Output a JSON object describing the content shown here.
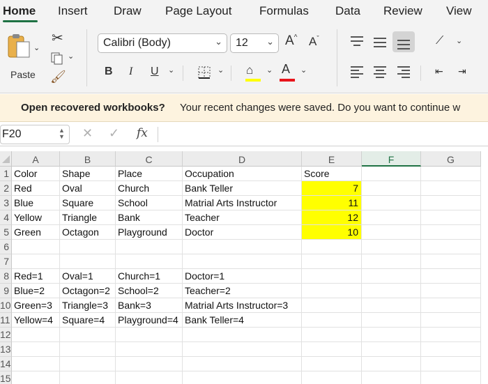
{
  "tabs": [
    "Home",
    "Insert",
    "Draw",
    "Page Layout",
    "Formulas",
    "Data",
    "Review",
    "View"
  ],
  "ribbon": {
    "paste_label": "Paste",
    "font_name": "Calibri (Body)",
    "font_size": "12",
    "grow_font": "A",
    "shrink_font": "A",
    "bold": "B",
    "italic": "I",
    "underline": "U",
    "font_color_glyph": "A",
    "fill_color": "#ffff00",
    "font_color": "#e8141b"
  },
  "message_bar": {
    "title": "Open recovered workbooks?",
    "text": "Your recent changes were saved. Do you want to continue w"
  },
  "formula_bar": {
    "name_box": "F20",
    "fx": "fx",
    "cancel": "✕",
    "ok": "✓",
    "formula": ""
  },
  "sheet": {
    "columns": [
      "A",
      "B",
      "C",
      "D",
      "E",
      "F",
      "G"
    ],
    "selected_column": "F",
    "rows": [
      "1",
      "2",
      "3",
      "4",
      "5",
      "6",
      "7",
      "8",
      "9",
      "10",
      "11",
      "12",
      "13",
      "14",
      "15"
    ],
    "highlight_color": "#ffff00",
    "cells": [
      [
        "Color",
        "Shape",
        "Place",
        "Occupation",
        "Score",
        "",
        ""
      ],
      [
        "Red",
        "Oval",
        "Church",
        "Bank Teller",
        "7",
        "",
        ""
      ],
      [
        "Blue",
        "Square",
        "School",
        "Matrial Arts Instructor",
        "11",
        "",
        ""
      ],
      [
        "Yellow",
        "Triangle",
        "Bank",
        "Teacher",
        "12",
        "",
        ""
      ],
      [
        "Green",
        "Octagon",
        "Playground",
        "Doctor",
        "10",
        "",
        ""
      ],
      [
        "",
        "",
        "",
        "",
        "",
        "",
        ""
      ],
      [
        "",
        "",
        "",
        "",
        "",
        "",
        ""
      ],
      [
        "Red=1",
        "Oval=1",
        "Church=1",
        "Doctor=1",
        "",
        "",
        ""
      ],
      [
        "Blue=2",
        "Octagon=2",
        "School=2",
        "Teacher=2",
        "",
        "",
        ""
      ],
      [
        "Green=3",
        "Triangle=3",
        "Bank=3",
        "Matrial Arts Instructor=3",
        "",
        "",
        ""
      ],
      [
        "Yellow=4",
        "Square=4",
        "Playground=4",
        "Bank Teller=4",
        "",
        "",
        ""
      ],
      [
        "",
        "",
        "",
        "",
        "",
        "",
        ""
      ],
      [
        "",
        "",
        "",
        "",
        "",
        "",
        ""
      ],
      [
        "",
        "",
        "",
        "",
        "",
        "",
        ""
      ],
      [
        "",
        "",
        "",
        "",
        "",
        "",
        ""
      ]
    ]
  }
}
